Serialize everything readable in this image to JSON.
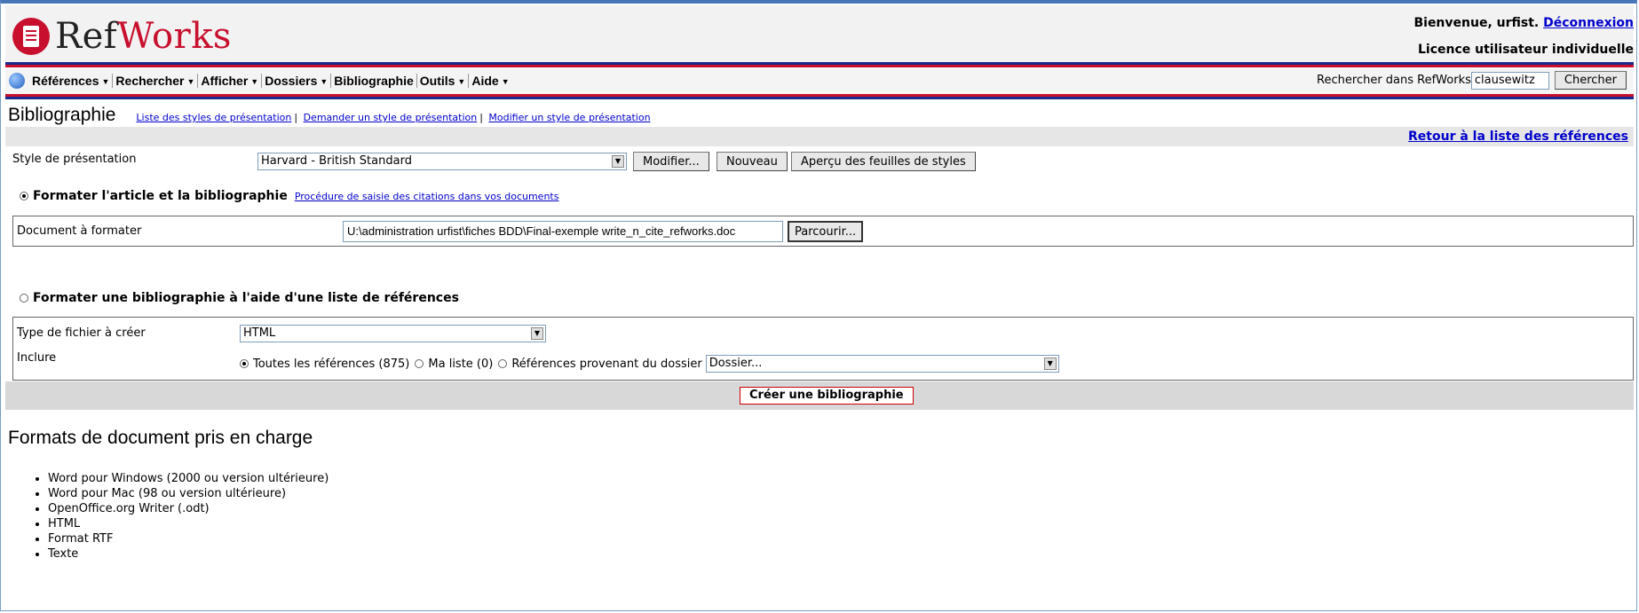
{
  "header": {
    "logo_ref": "Ref",
    "logo_works": "Works",
    "welcome_text": "Bienvenue, urfist.",
    "logout_link": "Déconnexion",
    "licence_text": "Licence utilisateur individuelle"
  },
  "nav": {
    "items": [
      "Références",
      "Rechercher",
      "Afficher",
      "Dossiers",
      "Bibliographie",
      "Outils",
      "Aide"
    ],
    "search_label": "Rechercher dans RefWorks",
    "search_value": "clausewitz",
    "search_button": "Chercher"
  },
  "page": {
    "title": "Bibliographie",
    "links": [
      "Liste des styles de présentation",
      "Demander un style de présentation",
      "Modifier un style de présentation"
    ],
    "back_link": "Retour à la liste des références"
  },
  "style_row": {
    "label": "Style de présentation",
    "selected": "Harvard - British Standard",
    "modify_button": "Modifier...",
    "new_button": "Nouveau",
    "preview_button": "Aperçu des feuilles de styles"
  },
  "option1": {
    "label": "Formater l'article et la bibliographie",
    "help_link": "Procédure de saisie des citations dans vos documents",
    "selected": true,
    "doc_label": "Document à formater",
    "doc_path": "U:\\administration urfist\\fiches BDD\\Final-exemple write_n_cite_refworks.doc",
    "browse_button": "Parcourir..."
  },
  "option2": {
    "label": "Formater une bibliographie à l'aide d'une liste de références",
    "selected": false,
    "filetype_label": "Type de fichier à créer",
    "filetype_value": "HTML",
    "include_label": "Inclure",
    "include_all": "Toutes les références (875)",
    "include_mylist": "Ma liste (0)",
    "include_folder": "Références provenant du dossier",
    "folder_value": "Dossier..."
  },
  "create_button": "Créer une bibliographie",
  "formats": {
    "title": "Formats de document pris en charge",
    "items": [
      "Word pour Windows (2000 ou version ultérieure)",
      "Word pour Mac (98 ou version ultérieure)",
      "OpenOffice.org Writer (.odt)",
      "HTML",
      "Format RTF",
      "Texte"
    ]
  },
  "colors": {
    "brand_red": "#c8102e",
    "brand_blue": "#1a2a8a",
    "link": "#0000cc"
  }
}
